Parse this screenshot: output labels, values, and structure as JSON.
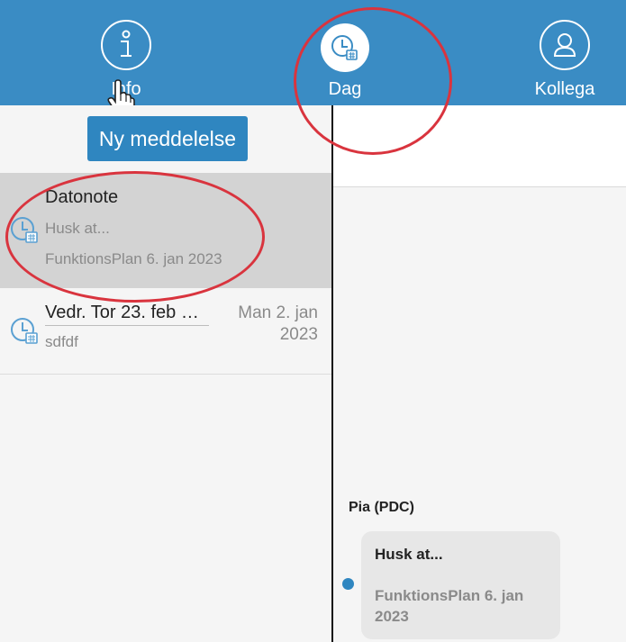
{
  "nav": {
    "info": {
      "label": "Info",
      "icon": "info-icon"
    },
    "day": {
      "label": "Dag",
      "icon": "clock-calendar-icon"
    },
    "colleague": {
      "label": "Kollega",
      "icon": "user-icon"
    }
  },
  "left": {
    "new_message_label": "Ny meddelelse",
    "messages": [
      {
        "title": "Datonote",
        "preview": "Husk at...",
        "meta": "FunktionsPlan 6. jan 2023",
        "icon": "clock-calendar-icon",
        "selected": true
      },
      {
        "title": "Vedr. Tor 23. feb …",
        "preview": "sdfdf",
        "date_line1": "Man 2. jan",
        "date_line2": "2023",
        "icon": "clock-calendar-icon",
        "selected": false
      }
    ]
  },
  "right": {
    "sender": "Pia (PDC)",
    "bubble_title": "Husk at...",
    "bubble_meta": "FunktionsPlan 6. jan 2023"
  },
  "colors": {
    "topbar": "#3a8cc4",
    "button": "#2f86c0",
    "annotation": "#d9343e",
    "selected_row": "#d3d3d3"
  }
}
